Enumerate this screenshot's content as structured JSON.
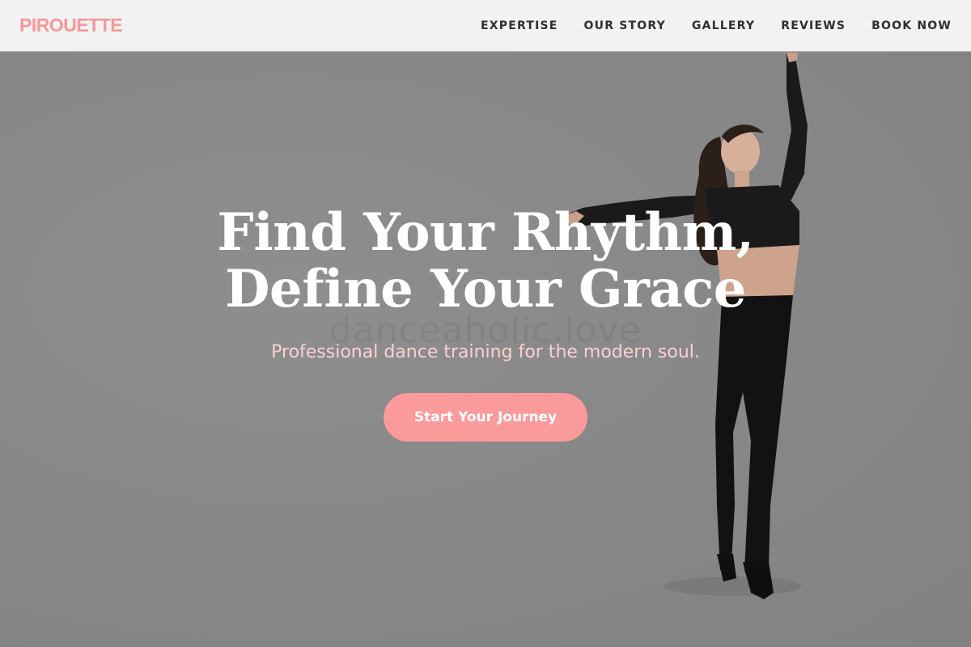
{
  "brand": {
    "logo": "PIROUETTE",
    "accent_color": "#f6979a"
  },
  "nav": {
    "items": [
      {
        "label": "EXPERTISE"
      },
      {
        "label": "OUR STORY"
      },
      {
        "label": "GALLERY"
      },
      {
        "label": "REVIEWS"
      },
      {
        "label": "BOOK NOW"
      }
    ]
  },
  "hero": {
    "title_line1": "Find Your Rhythm,",
    "title_line2": "Define Your Grace",
    "watermark": "danceaholic.love",
    "subtitle": "Professional dance training for the modern soul.",
    "cta_label": "Start Your Journey",
    "cta_color": "#fa9a9b",
    "image": "dancer-in-black-outfit"
  }
}
